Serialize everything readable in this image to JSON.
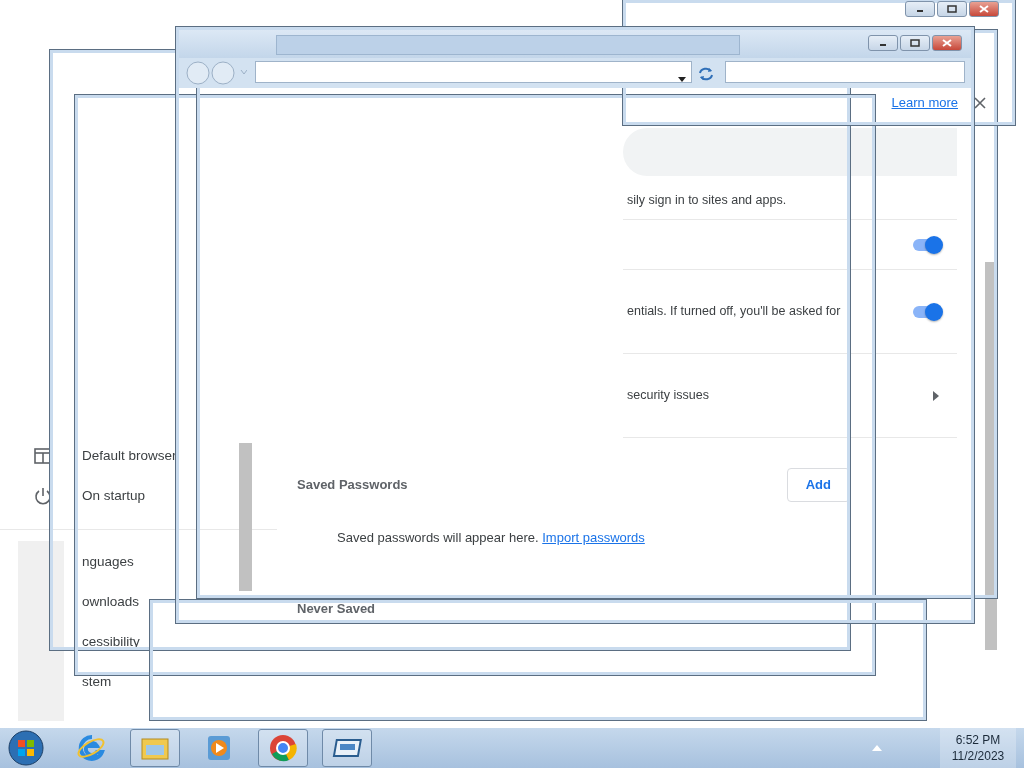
{
  "banner": {
    "link": "Learn more"
  },
  "sidebar": {
    "items": [
      {
        "kind": "browser",
        "label": "Default browser"
      },
      {
        "kind": "power",
        "label": "On startup"
      },
      {
        "kind": "divider"
      },
      {
        "kind": "plain",
        "label": "nguages"
      },
      {
        "kind": "plain",
        "label": "ownloads"
      },
      {
        "kind": "plain",
        "label": "cessibility"
      },
      {
        "kind": "plain",
        "label": "stem"
      }
    ]
  },
  "settings_rows": [
    {
      "kind": "text",
      "text": "sily sign in to sites and apps."
    },
    {
      "kind": "toggle",
      "on": true
    },
    {
      "kind": "toggle",
      "text": "entials. If turned off, you'll be asked for",
      "on": true
    },
    {
      "kind": "link",
      "text": "security issues"
    }
  ],
  "saved_passwords": {
    "title": "Saved Passwords",
    "add": "Add",
    "empty_text": "Saved passwords will appear here.",
    "import_link": "Import passwords"
  },
  "never_saved": {
    "title": "Never Saved"
  },
  "taskbar": {
    "apps": [
      {
        "kind": "ie",
        "running": false
      },
      {
        "kind": "folder",
        "running": true
      },
      {
        "kind": "media",
        "running": false
      },
      {
        "kind": "chrome",
        "running": true
      },
      {
        "kind": "window",
        "running": true
      }
    ],
    "time": "6:52 PM",
    "date": "11/2/2023"
  }
}
